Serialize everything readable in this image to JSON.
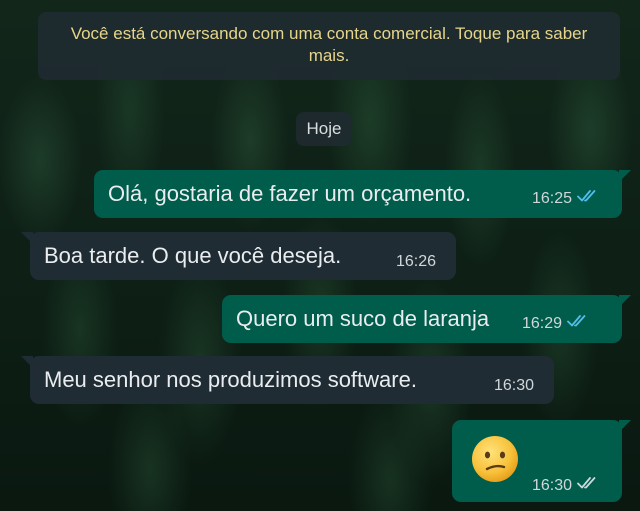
{
  "banner": {
    "text": "Você está conversando com uma conta comercial. Toque para saber mais."
  },
  "date_chip": "Hoje",
  "messages": [
    {
      "direction": "outgoing",
      "text": "Olá, gostaria de fazer um orçamento.",
      "time": "16:25",
      "status": "read"
    },
    {
      "direction": "incoming",
      "text": "Boa tarde. O que você deseja.",
      "time": "16:26"
    },
    {
      "direction": "outgoing",
      "text": "Quero um suco de laranja",
      "time": "16:29",
      "status": "read"
    },
    {
      "direction": "incoming",
      "text": "Meu senhor nos produzimos software.",
      "time": "16:30"
    },
    {
      "direction": "outgoing",
      "emoji": "confused-face",
      "time": "16:30",
      "status": "delivered"
    }
  ],
  "colors": {
    "outgoing_bubble": "#005c4b",
    "incoming_bubble": "#202c33",
    "read_ticks": "#53bdeb",
    "delivered_ticks": "#d0d7da"
  }
}
